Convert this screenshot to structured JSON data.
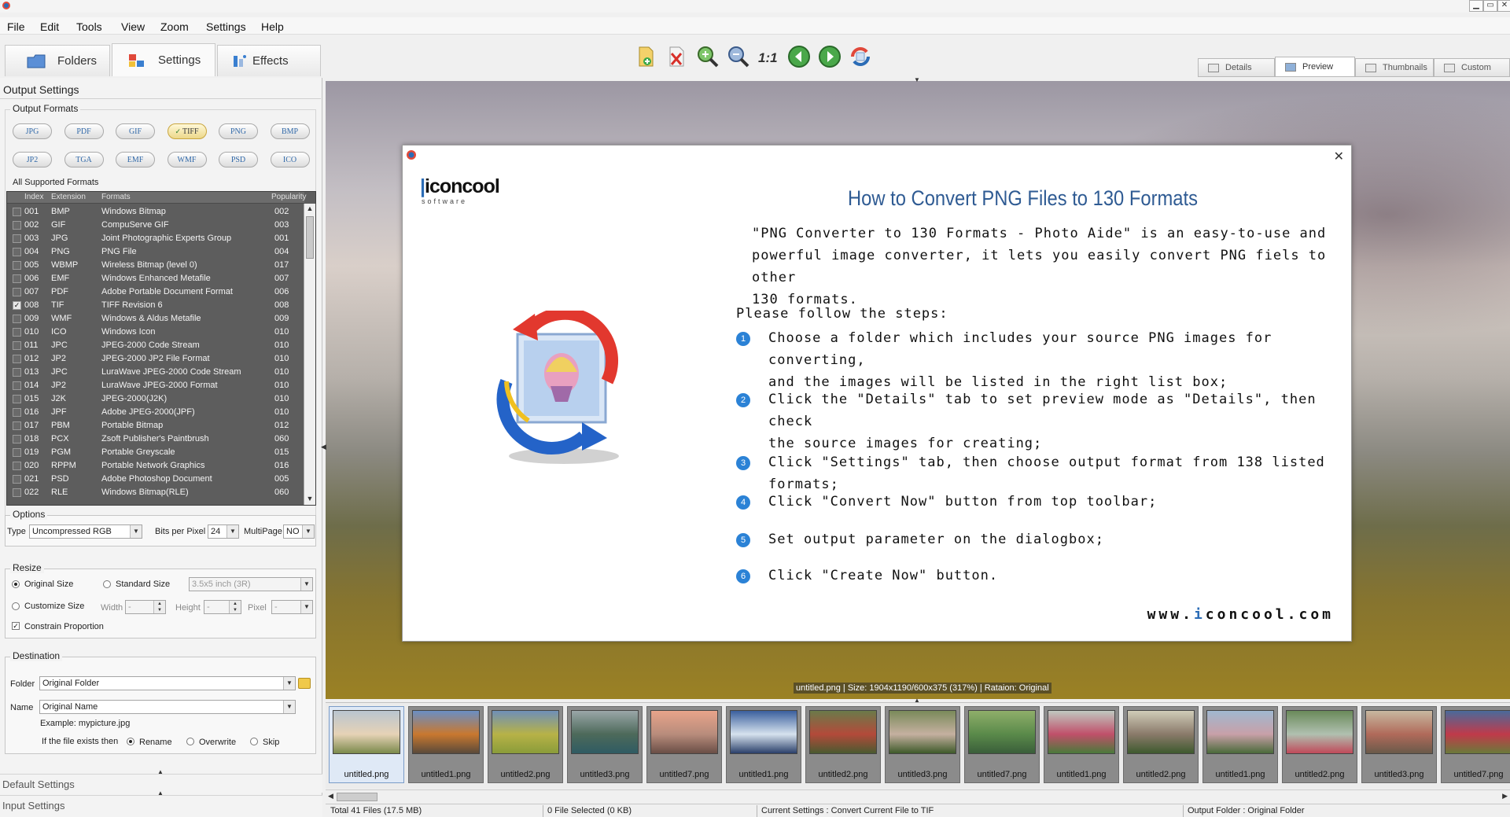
{
  "menu": [
    "File",
    "Edit",
    "Tools",
    "View",
    "Zoom",
    "Settings",
    "Help"
  ],
  "tabs": {
    "folders": "Folders",
    "settings": "Settings",
    "effects": "Effects"
  },
  "view_tabs": [
    "Details",
    "Preview",
    "Thumbnails",
    "Custom"
  ],
  "left": {
    "title": "Output Settings",
    "output_formats_title": "Output Formats",
    "format_buttons": [
      "JPG",
      "PDF",
      "GIF",
      "TIFF",
      "PNG",
      "BMP",
      "JP2",
      "TGA",
      "EMF",
      "WMF",
      "PSD",
      "ICO"
    ],
    "selected_format": "TIFF",
    "all_formats_label": "All Supported Formats",
    "list_headers": {
      "index": "Index",
      "extension": "Extension",
      "formats": "Formats",
      "popularity": "Popularity"
    },
    "format_rows": [
      {
        "index": "001",
        "ext": "BMP",
        "name": "Windows Bitmap",
        "pop": "002",
        "checked": false
      },
      {
        "index": "002",
        "ext": "GIF",
        "name": "CompuServe GIF",
        "pop": "003",
        "checked": false
      },
      {
        "index": "003",
        "ext": "JPG",
        "name": "Joint Photographic Experts Group",
        "pop": "001",
        "checked": false
      },
      {
        "index": "004",
        "ext": "PNG",
        "name": "PNG File",
        "pop": "004",
        "checked": false
      },
      {
        "index": "005",
        "ext": "WBMP",
        "name": "Wireless Bitmap (level 0)",
        "pop": "017",
        "checked": false
      },
      {
        "index": "006",
        "ext": "EMF",
        "name": "Windows Enhanced Metafile",
        "pop": "007",
        "checked": false
      },
      {
        "index": "007",
        "ext": "PDF",
        "name": "Adobe Portable Document Format",
        "pop": "006",
        "checked": false
      },
      {
        "index": "008",
        "ext": "TIF",
        "name": "TIFF Revision 6",
        "pop": "008",
        "checked": true
      },
      {
        "index": "009",
        "ext": "WMF",
        "name": "Windows & Aldus Metafile",
        "pop": "009",
        "checked": false
      },
      {
        "index": "010",
        "ext": "ICO",
        "name": "Windows Icon",
        "pop": "010",
        "checked": false
      },
      {
        "index": "011",
        "ext": "JPC",
        "name": "JPEG-2000 Code Stream",
        "pop": "010",
        "checked": false
      },
      {
        "index": "012",
        "ext": "JP2",
        "name": "JPEG-2000 JP2 File Format",
        "pop": "010",
        "checked": false
      },
      {
        "index": "013",
        "ext": "JPC",
        "name": "LuraWave JPEG-2000 Code Stream",
        "pop": "010",
        "checked": false
      },
      {
        "index": "014",
        "ext": "JP2",
        "name": "LuraWave JPEG-2000 Format",
        "pop": "010",
        "checked": false
      },
      {
        "index": "015",
        "ext": "J2K",
        "name": "JPEG-2000(J2K)",
        "pop": "010",
        "checked": false
      },
      {
        "index": "016",
        "ext": "JPF",
        "name": "Adobe JPEG-2000(JPF)",
        "pop": "010",
        "checked": false
      },
      {
        "index": "017",
        "ext": "PBM",
        "name": "Portable Bitmap",
        "pop": "012",
        "checked": false
      },
      {
        "index": "018",
        "ext": "PCX",
        "name": "Zsoft Publisher's Paintbrush",
        "pop": "060",
        "checked": false
      },
      {
        "index": "019",
        "ext": "PGM",
        "name": "Portable Greyscale",
        "pop": "015",
        "checked": false
      },
      {
        "index": "020",
        "ext": "RPPM",
        "name": "Portable Network Graphics",
        "pop": "016",
        "checked": false
      },
      {
        "index": "021",
        "ext": "PSD",
        "name": "Adobe Photoshop Document",
        "pop": "005",
        "checked": false
      },
      {
        "index": "022",
        "ext": "RLE",
        "name": "Windows Bitmap(RLE)",
        "pop": "060",
        "checked": false
      }
    ],
    "options": {
      "title": "Options",
      "type_label": "Type",
      "type_value": "Uncompressed RGB",
      "bpp_label": "Bits per Pixel",
      "bpp_value": "24",
      "multipage_label": "MultiPage",
      "multipage_value": "NO"
    },
    "resize": {
      "title": "Resize",
      "original_size": "Original Size",
      "standard_size": "Standard Size",
      "standard_value": "3.5x5 inch (3R)",
      "customize_size": "Customize Size",
      "width_label": "Width",
      "width_value": "-",
      "height_label": "Height",
      "height_value": "-",
      "pixel_label": "Pixel",
      "pixel_value": "-",
      "constrain": "Constrain Proportion"
    },
    "destination": {
      "title": "Destination",
      "folder_label": "Folder",
      "folder_value": "Original Folder",
      "name_label": "Name",
      "name_value": "Original Name",
      "example": "Example: mypicture.jpg",
      "exists_label": "If the file exists then",
      "rename": "Rename",
      "overwrite": "Overwrite",
      "skip": "Skip"
    },
    "default_settings": "Default Settings",
    "input_settings": "Input Settings"
  },
  "preview": {
    "status_text": "untitled.png  |  Size: 1904x1190/600x375 (317%)  |  Rataion: Original"
  },
  "dialog": {
    "logo_text": "iconcool",
    "logo_sub": "software",
    "title": "How to Convert PNG Files to 130 Formats",
    "intro_lines": [
      "\"PNG Converter to 130 Formats - Photo Aide\" is an easy-to-use and",
      "powerful image converter, it lets you easily convert PNG fiels to other",
      "130 formats."
    ],
    "please": "Please follow the steps:",
    "steps": [
      {
        "num": "1",
        "lines": [
          "Choose a folder which includes your source PNG images for converting,",
          "and the images will be listed in the right list box;"
        ]
      },
      {
        "num": "2",
        "lines": [
          "Click the \"Details\" tab to set preview mode as \"Details\", then check",
          "the source images for creating;"
        ]
      },
      {
        "num": "3",
        "lines": [
          "Click \"Settings\" tab, then choose output format from 138 listed formats;"
        ]
      },
      {
        "num": "4",
        "lines": [
          "Click \"Convert Now\" button from top toolbar;"
        ]
      },
      {
        "num": "5",
        "lines": [
          "Set output parameter on the dialogbox;"
        ]
      },
      {
        "num": "6",
        "lines": [
          "Click \"Create Now\" button."
        ]
      }
    ],
    "url_prefix": "www.",
    "url_i": "i",
    "url_rest": "concool.com"
  },
  "thumbnails": [
    {
      "name": "untitled.png",
      "colors": [
        "#b9c5d0",
        "#e6d2b6",
        "#7b8a4c"
      ]
    },
    {
      "name": "untitled1.png",
      "colors": [
        "#6a8fc4",
        "#c9782f",
        "#5a4a3a"
      ]
    },
    {
      "name": "untitled2.png",
      "colors": [
        "#6f8fb8",
        "#b7b247",
        "#8a9c3a"
      ]
    },
    {
      "name": "untitled3.png",
      "colors": [
        "#9aa6a8",
        "#4d6a5a",
        "#2f5b63"
      ]
    },
    {
      "name": "untitled7.png",
      "colors": [
        "#e8a48a",
        "#b88c7c",
        "#6a4e46"
      ]
    },
    {
      "name": "untitled1.png",
      "colors": [
        "#3a5f9e",
        "#d6e2ee",
        "#2a3f6a"
      ]
    },
    {
      "name": "untitled2.png",
      "colors": [
        "#6b7a4a",
        "#b34a3a",
        "#4a5a30"
      ]
    },
    {
      "name": "untitled3.png",
      "colors": [
        "#7a8a5a",
        "#c5b0a0",
        "#3e5a2a"
      ]
    },
    {
      "name": "untitled7.png",
      "colors": [
        "#8fae6a",
        "#5a8a4a",
        "#3a5e3a"
      ]
    },
    {
      "name": "untitled1.png",
      "colors": [
        "#c0c8c0",
        "#c0506a",
        "#4a7a3a"
      ]
    },
    {
      "name": "untitled2.png",
      "colors": [
        "#d0ccb8",
        "#8a7a6a",
        "#3e5a2e"
      ]
    },
    {
      "name": "untitled1.png",
      "colors": [
        "#a0b8d0",
        "#c8a0a8",
        "#4a6a3a"
      ]
    },
    {
      "name": "untitled2.png",
      "colors": [
        "#6a8a5a",
        "#b0c0b0",
        "#c04a5a"
      ]
    },
    {
      "name": "untitled3.png",
      "colors": [
        "#c8b8a0",
        "#b06a5a",
        "#6a5a4a"
      ]
    },
    {
      "name": "untitled7.png",
      "colors": [
        "#4a6a9a",
        "#c03a4a",
        "#6a7a3a"
      ]
    }
  ],
  "statusbar": {
    "total": "Total 41 Files (17.5 MB)",
    "selected": "0 File Selected (0 KB)",
    "current": "Current Settings : Convert Current File to TIF",
    "output": "Output Folder : Original Folder"
  },
  "colors": {
    "accent_blue": "#2b6cb6",
    "list_bg": "#5d5d5d",
    "step_badge": "#2b82d6"
  }
}
